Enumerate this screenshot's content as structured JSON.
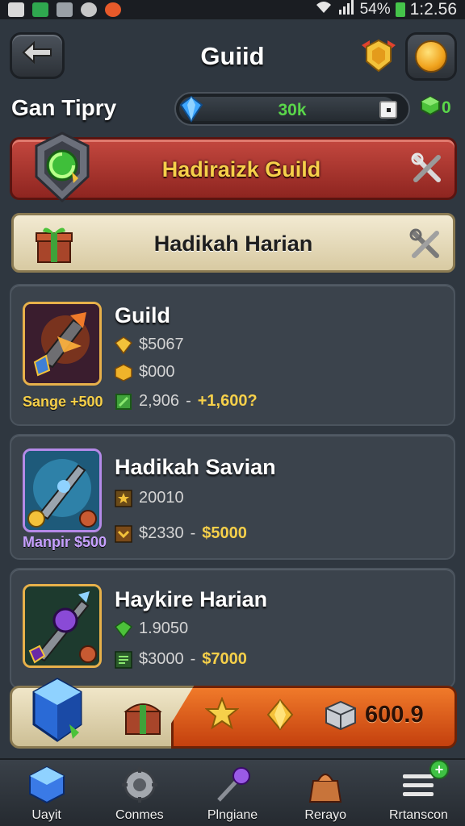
{
  "status_bar": {
    "battery": "54%",
    "time": "1:2.56"
  },
  "header": {
    "title": "Guiid"
  },
  "progress": {
    "label": "Gan Tipry",
    "text": "30k",
    "green_gems": "0"
  },
  "banner_guild": {
    "label": "Hadiraizk Guild"
  },
  "banner_daily": {
    "label": "Hadikah Harian"
  },
  "cards": [
    {
      "name": "Guild",
      "stat1": "$5067",
      "stat2": "$000",
      "range_low": "2,906",
      "sep": "-",
      "range_high": "+1,600?",
      "sub": "Sange +500"
    },
    {
      "name": "Hadikah Savian",
      "stat1": "20010",
      "range_low": "$2330",
      "sep": "-",
      "range_high": "$5000",
      "sub": "Manpir $500"
    },
    {
      "name": "Haykire Harian",
      "stat1": "1.9050",
      "range_low": "$3000",
      "sep": "-",
      "range_high": "$7000"
    }
  ],
  "promo": {
    "value": "600.9"
  },
  "nav": [
    {
      "label": "Uayit",
      "icon": "blue-cube-icon"
    },
    {
      "label": "Conmes",
      "icon": "gear-helmet-icon"
    },
    {
      "label": "Plngiane",
      "icon": "magic-staff-icon"
    },
    {
      "label": "Rerayo",
      "icon": "treasure-bag-icon"
    },
    {
      "label": "Rrtanscon",
      "icon": "menu-icon"
    }
  ],
  "colors": {
    "accent_gold": "#f6d04a",
    "accent_green": "#5ad64a",
    "banner_red": "#c4483f",
    "promo_orange": "#f07a2a"
  }
}
